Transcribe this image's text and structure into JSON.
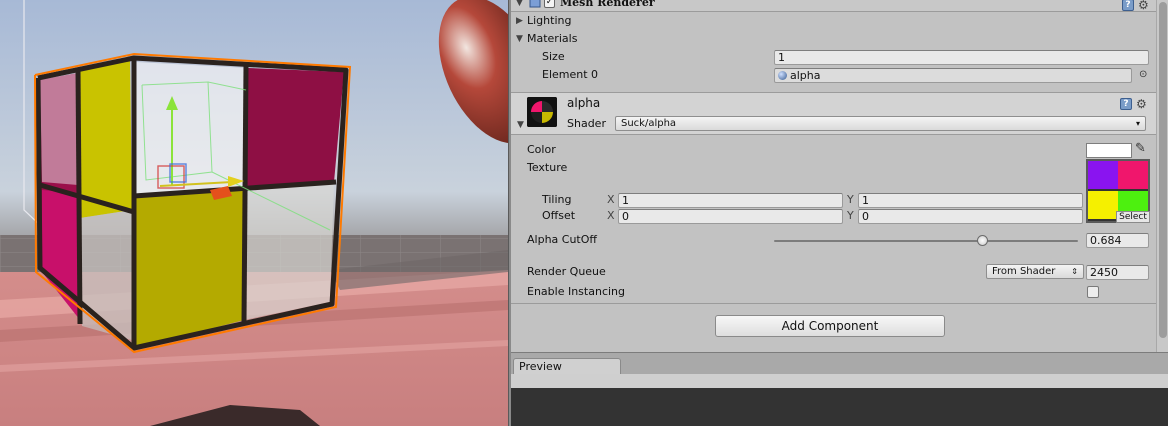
{
  "component": {
    "title": "Mesh Renderer",
    "lighting_label": "Lighting",
    "materials_label": "Materials",
    "size_label": "Size",
    "size_value": "1",
    "element0_label": "Element 0",
    "element0_value": "alpha"
  },
  "material": {
    "name": "alpha",
    "shader_label": "Shader",
    "shader_value": "Suck/alpha"
  },
  "properties": {
    "color_label": "Color",
    "color_value": "#ffffff",
    "texture_label": "Texture",
    "texture_select": "Select",
    "tiling_label": "Tiling",
    "offset_label": "Offset",
    "x_label": "X",
    "y_label": "Y",
    "tiling_x": "1",
    "tiling_y": "1",
    "offset_x": "0",
    "offset_y": "0",
    "alpha_cutoff_label": "Alpha CutOff",
    "alpha_cutoff_value": "0.684",
    "render_queue_label": "Render Queue",
    "render_queue_mode": "From Shader",
    "render_queue_value": "2450",
    "enable_instancing_label": "Enable Instancing",
    "enable_instancing_checked": false
  },
  "buttons": {
    "add_component": "Add Component"
  },
  "preview": {
    "tab_label": "Preview"
  },
  "colors": {
    "inspector_bg": "#c2c2c2",
    "texture_quadrants": [
      "#8a14f0",
      "#f0166c",
      "#f5f000",
      "#4df00f"
    ],
    "cube_yellow": "#c9c300",
    "cube_magenta": "#9b0f4a",
    "selection_outline": "#ff7a00"
  }
}
